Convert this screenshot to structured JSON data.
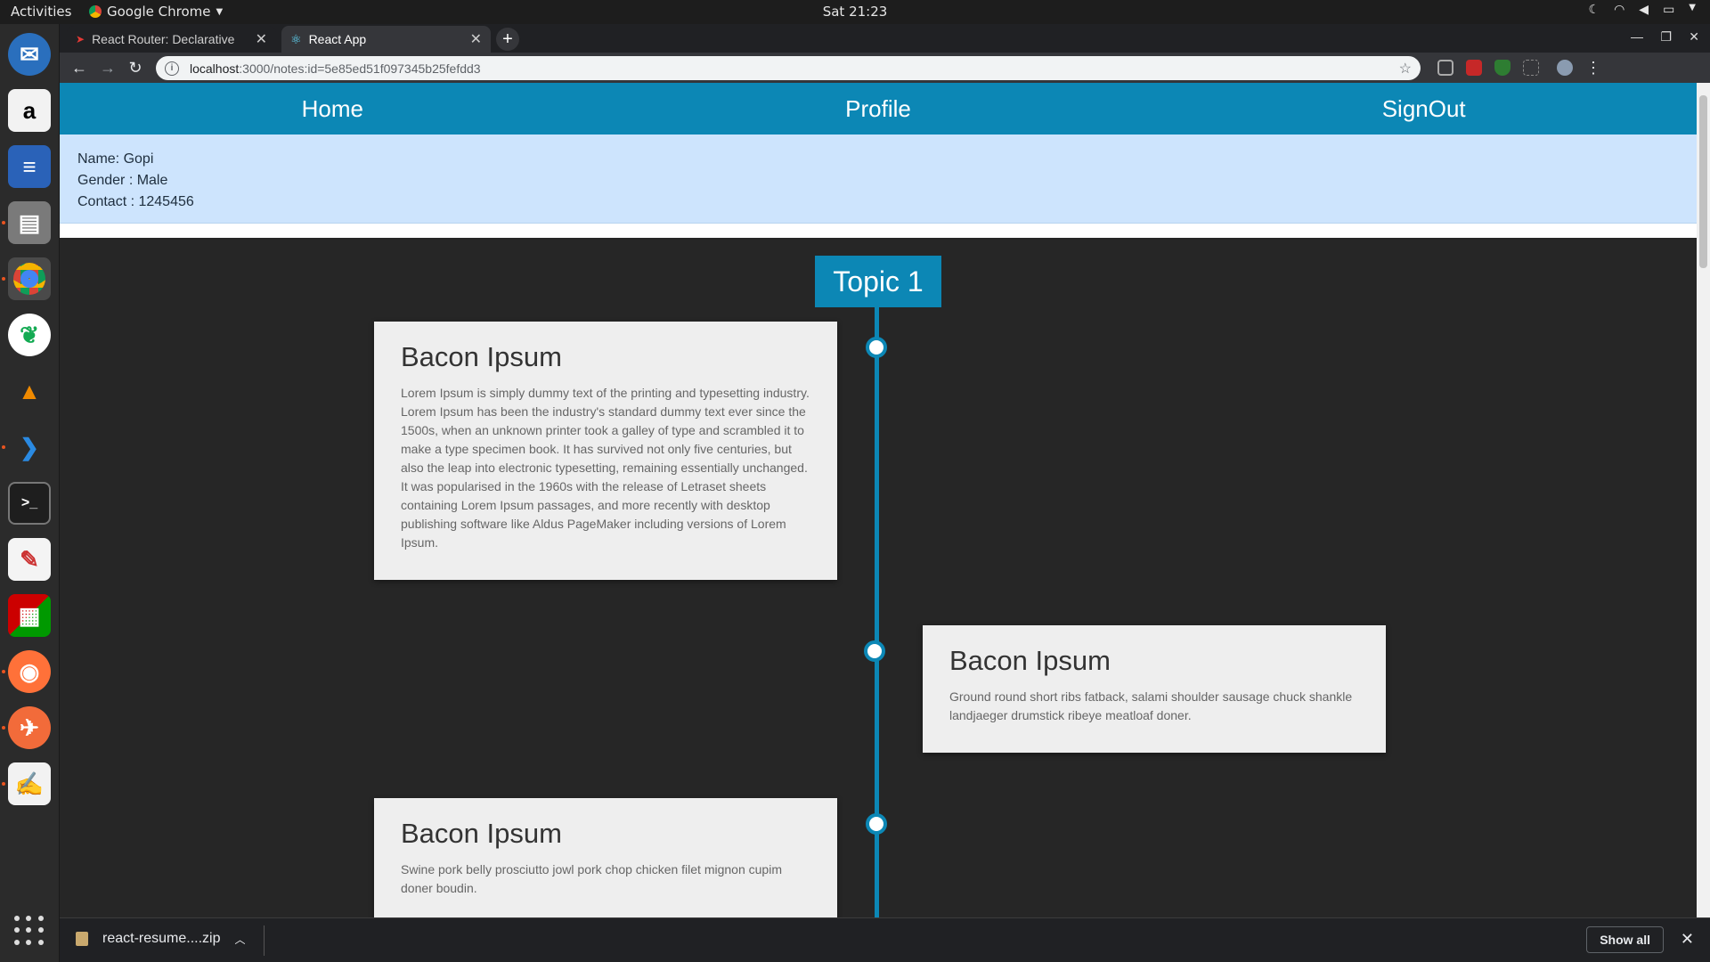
{
  "topbar": {
    "activities": "Activities",
    "app_name": "Google Chrome",
    "clock": "Sat 21:23"
  },
  "browser": {
    "tabs": [
      {
        "title": "React Router: Declarative",
        "active": false
      },
      {
        "title": "React App",
        "active": true
      }
    ],
    "url_host": "localhost",
    "url_path": ":3000/notes:id=5e85ed51f097345b25fefdd3"
  },
  "app": {
    "nav": [
      {
        "label": "Home"
      },
      {
        "label": "Profile"
      },
      {
        "label": "SignOut"
      }
    ],
    "user": {
      "name": "Name: Gopi",
      "gender": "Gender : Male",
      "contact": "Contact : 1245456"
    },
    "topic": "Topic 1",
    "cards": [
      {
        "title": "Bacon Ipsum",
        "side": "left",
        "body": "Lorem Ipsum is simply dummy text of the printing and typesetting industry. Lorem Ipsum has been the industry's standard dummy text ever since the 1500s, when an unknown printer took a galley of type and scrambled it to make a type specimen book. It has survived not only five centuries, but also the leap into electronic typesetting, remaining essentially unchanged. It was popularised in the 1960s with the release of Letraset sheets containing Lorem Ipsum passages, and more recently with desktop publishing software like Aldus PageMaker including versions of Lorem Ipsum."
      },
      {
        "title": "Bacon Ipsum",
        "side": "right",
        "body": "Ground round short ribs fatback, salami shoulder sausage chuck shankle landjaeger drumstick ribeye meatloaf doner."
      },
      {
        "title": "Bacon Ipsum",
        "side": "left",
        "body": "Swine pork belly prosciutto jowl pork chop chicken filet mignon cupim doner boudin."
      }
    ]
  },
  "downloads": {
    "file": "react-resume....zip",
    "show_all": "Show all"
  },
  "colors": {
    "accent": "#0c87b5",
    "info_bg": "#cde4fd",
    "page_bg": "#262626",
    "card_bg": "#eeeeee"
  }
}
